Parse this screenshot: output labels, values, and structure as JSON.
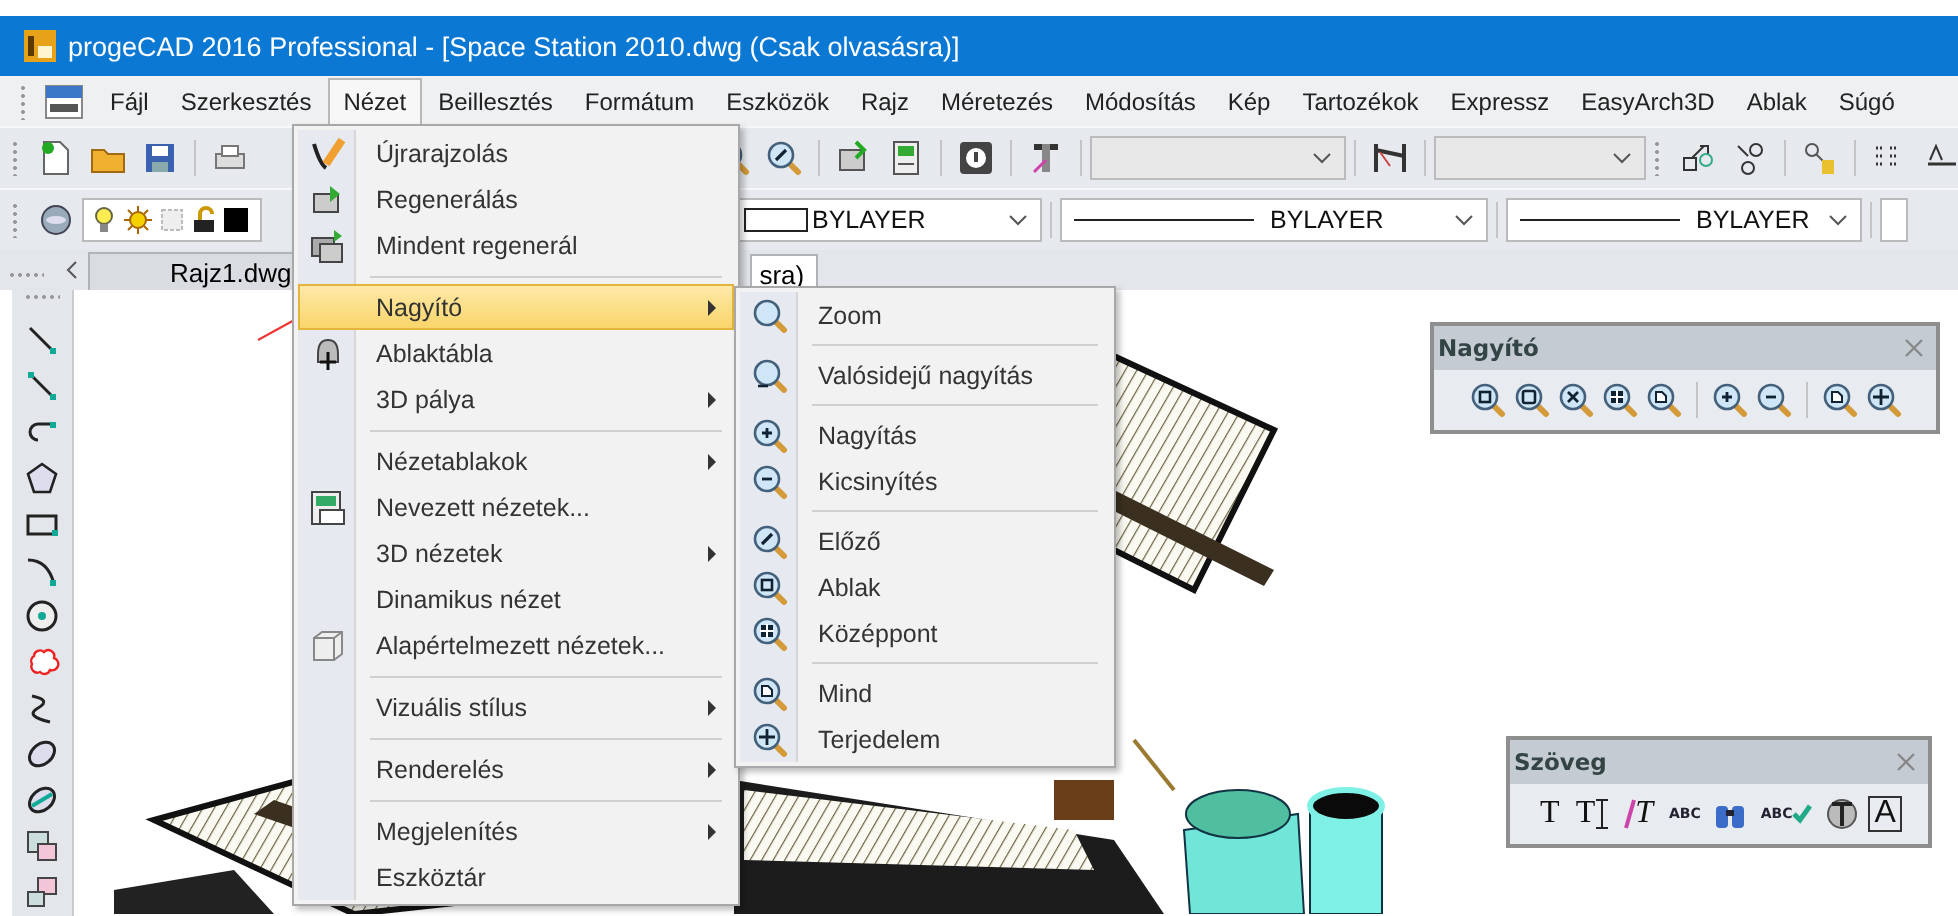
{
  "window": {
    "title": "progeCAD 2016 Professional - [Space Station 2010.dwg (Csak olvasásra)]"
  },
  "menu_bar": [
    {
      "label": "Fájl",
      "selected": false
    },
    {
      "label": "Szerkesztés",
      "selected": false
    },
    {
      "label": "Nézet",
      "selected": true
    },
    {
      "label": "Beillesztés",
      "selected": false
    },
    {
      "label": "Formátum",
      "selected": false
    },
    {
      "label": "Eszközök",
      "selected": false
    },
    {
      "label": "Rajz",
      "selected": false
    },
    {
      "label": "Méretezés",
      "selected": false
    },
    {
      "label": "Módosítás",
      "selected": false
    },
    {
      "label": "Kép",
      "selected": false
    },
    {
      "label": "Tartozékok",
      "selected": false
    },
    {
      "label": "Expressz",
      "selected": false
    },
    {
      "label": "EasyArch3D",
      "selected": false
    },
    {
      "label": "Ablak",
      "selected": false
    },
    {
      "label": "Súgó",
      "selected": false
    }
  ],
  "property_combos": [
    {
      "kind": "color",
      "value": "BYLAYER"
    },
    {
      "kind": "linetype",
      "value": "BYLAYER"
    },
    {
      "kind": "lineweight",
      "value": "BYLAYER"
    }
  ],
  "document_tabs": [
    {
      "label": "Rajz1.dwg",
      "selected": false
    },
    {
      "label": "sra)",
      "selected": true
    }
  ],
  "view_menu": {
    "items": [
      {
        "kind": "item",
        "label": "Újrarajzolás",
        "submenu": false,
        "selected": false
      },
      {
        "kind": "item",
        "label": "Regenerálás",
        "submenu": false,
        "selected": false
      },
      {
        "kind": "item",
        "label": "Mindent regenerál",
        "submenu": false,
        "selected": false
      },
      {
        "kind": "separator"
      },
      {
        "kind": "item",
        "label": "Nagyító",
        "submenu": true,
        "selected": true
      },
      {
        "kind": "item",
        "label": "Ablaktábla",
        "submenu": false,
        "selected": false
      },
      {
        "kind": "item",
        "label": "3D pálya",
        "submenu": true,
        "selected": false
      },
      {
        "kind": "separator"
      },
      {
        "kind": "item",
        "label": "Nézetablakok",
        "submenu": true,
        "selected": false
      },
      {
        "kind": "item",
        "label": "Nevezett nézetek...",
        "submenu": false,
        "selected": false
      },
      {
        "kind": "item",
        "label": "3D nézetek",
        "submenu": true,
        "selected": false
      },
      {
        "kind": "item",
        "label": "Dinamikus nézet",
        "submenu": false,
        "selected": false
      },
      {
        "kind": "item",
        "label": "Alapértelmezett nézetek...",
        "submenu": false,
        "selected": false
      },
      {
        "kind": "separator"
      },
      {
        "kind": "item",
        "label": "Vizuális stílus",
        "submenu": true,
        "selected": false
      },
      {
        "kind": "separator"
      },
      {
        "kind": "item",
        "label": "Renderelés",
        "submenu": true,
        "selected": false
      },
      {
        "kind": "separator"
      },
      {
        "kind": "item",
        "label": "Megjelenítés",
        "submenu": true,
        "selected": false
      },
      {
        "kind": "item",
        "label": "Eszköztár",
        "submenu": false,
        "selected": false
      }
    ]
  },
  "zoom_submenu": {
    "items": [
      {
        "kind": "item",
        "label": "Zoom"
      },
      {
        "kind": "separator"
      },
      {
        "kind": "item",
        "label": "Valósidejű nagyítás"
      },
      {
        "kind": "separator"
      },
      {
        "kind": "item",
        "label": "Nagyítás"
      },
      {
        "kind": "item",
        "label": "Kicsinyítés"
      },
      {
        "kind": "separator"
      },
      {
        "kind": "item",
        "label": "Előző"
      },
      {
        "kind": "item",
        "label": "Ablak"
      },
      {
        "kind": "item",
        "label": "Középpont"
      },
      {
        "kind": "separator"
      },
      {
        "kind": "item",
        "label": "Mind"
      },
      {
        "kind": "item",
        "label": "Terjedelem"
      }
    ]
  },
  "floating_toolbars": [
    {
      "kind": "zoom",
      "title": "Nagyító"
    },
    {
      "kind": "text",
      "title": "Szöveg",
      "buttons": [
        {
          "kind": "serif",
          "glyph": "T"
        },
        {
          "kind": "ibeam",
          "glyph": "T"
        },
        {
          "kind": "italic",
          "glyph": "T"
        },
        {
          "kind": "arc",
          "glyph": "ABC"
        },
        {
          "kind": "binoculars"
        },
        {
          "kind": "check",
          "glyph": "ABC"
        },
        {
          "kind": "style"
        },
        {
          "kind": "frame",
          "glyph": "A"
        }
      ]
    }
  ]
}
